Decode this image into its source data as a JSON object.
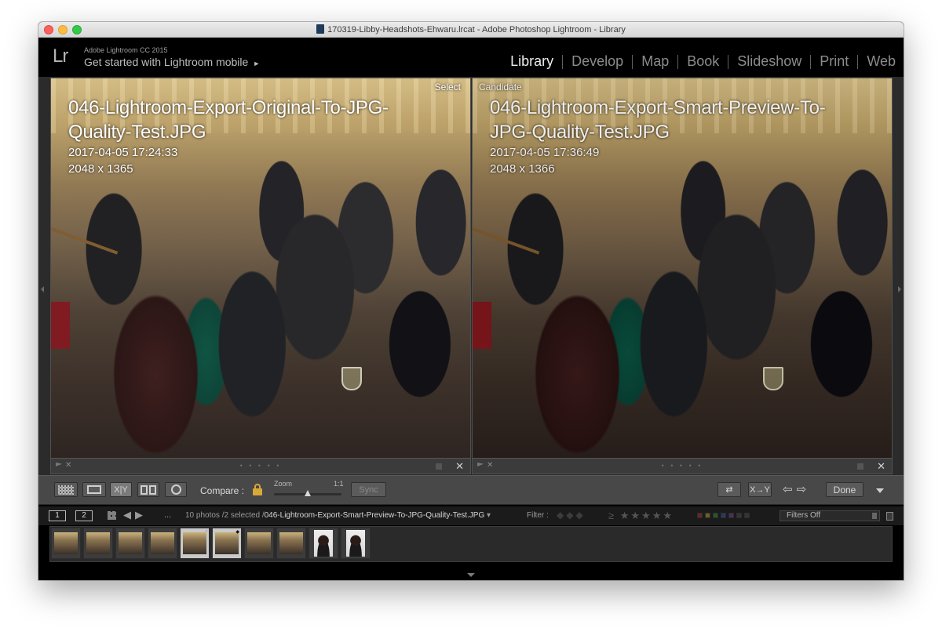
{
  "window": {
    "title": "170319-Libby-Headshots-Ehwaru.lrcat - Adobe Photoshop Lightroom - Library"
  },
  "header": {
    "logo": "Lr",
    "brand_small": "Adobe Lightroom CC 2015",
    "brand_big": "Get started with Lightroom mobile",
    "brand_arrow": "►"
  },
  "modules": [
    "Library",
    "Develop",
    "Map",
    "Book",
    "Slideshow",
    "Print",
    "Web"
  ],
  "active_module": "Library",
  "compare": {
    "select": {
      "label": "Select",
      "filename": "046-Lightroom-Export-Original-To-JPG-Quality-Test.JPG",
      "date": "2017-04-05 17:24:33",
      "dimensions": "2048 x 1365"
    },
    "candidate": {
      "label": "Candidate",
      "filename": "046-Lightroom-Export-Smart-Preview-To-JPG-Quality-Test.JPG",
      "date": "2017-04-05 17:36:49",
      "dimensions": "2048 x 1366"
    }
  },
  "pane_bar": {
    "dots": "• • • • •",
    "close": "✕",
    "reject": "✕"
  },
  "toolbar": {
    "xy_label": "X|Y",
    "compare_label": "Compare :",
    "zoom_label": "Zoom",
    "zoom_ratio": "1:1",
    "zoom_level": 0.5,
    "sync_label": "Sync",
    "swap_label": "⇄",
    "make_select_label": "X→Y",
    "arrows": "⇦⇨",
    "done_label": "Done"
  },
  "filmstrip_bar": {
    "screen1": "1",
    "screen2": "2",
    "nav": "◀▶",
    "ellipsis": "...",
    "count_text": "10 photos /2 selected /",
    "current_file": "046-Lightroom-Export-Smart-Preview-To-JPG-Quality-Test.JPG",
    "dropdown_caret": "▾",
    "filter_label": "Filter :",
    "flags": "◆◆◆",
    "stars": "≥ ★★★★★",
    "filters_value": "Filters Off"
  },
  "color_labels": [
    "#c0392b",
    "#d4b22f",
    "#3e9b3e",
    "#3b5fb5",
    "#7d4bb0",
    "#555555",
    "#555555"
  ],
  "thumbnails": [
    {
      "kind": "event",
      "selected": false
    },
    {
      "kind": "event",
      "selected": false
    },
    {
      "kind": "event",
      "selected": false
    },
    {
      "kind": "event",
      "selected": false
    },
    {
      "kind": "event",
      "selected": true,
      "badge": "◦"
    },
    {
      "kind": "event",
      "selected": true,
      "badge": "◆"
    },
    {
      "kind": "event",
      "selected": false
    },
    {
      "kind": "event",
      "selected": false
    },
    {
      "kind": "portrait",
      "selected": false
    },
    {
      "kind": "portrait",
      "selected": false
    }
  ]
}
